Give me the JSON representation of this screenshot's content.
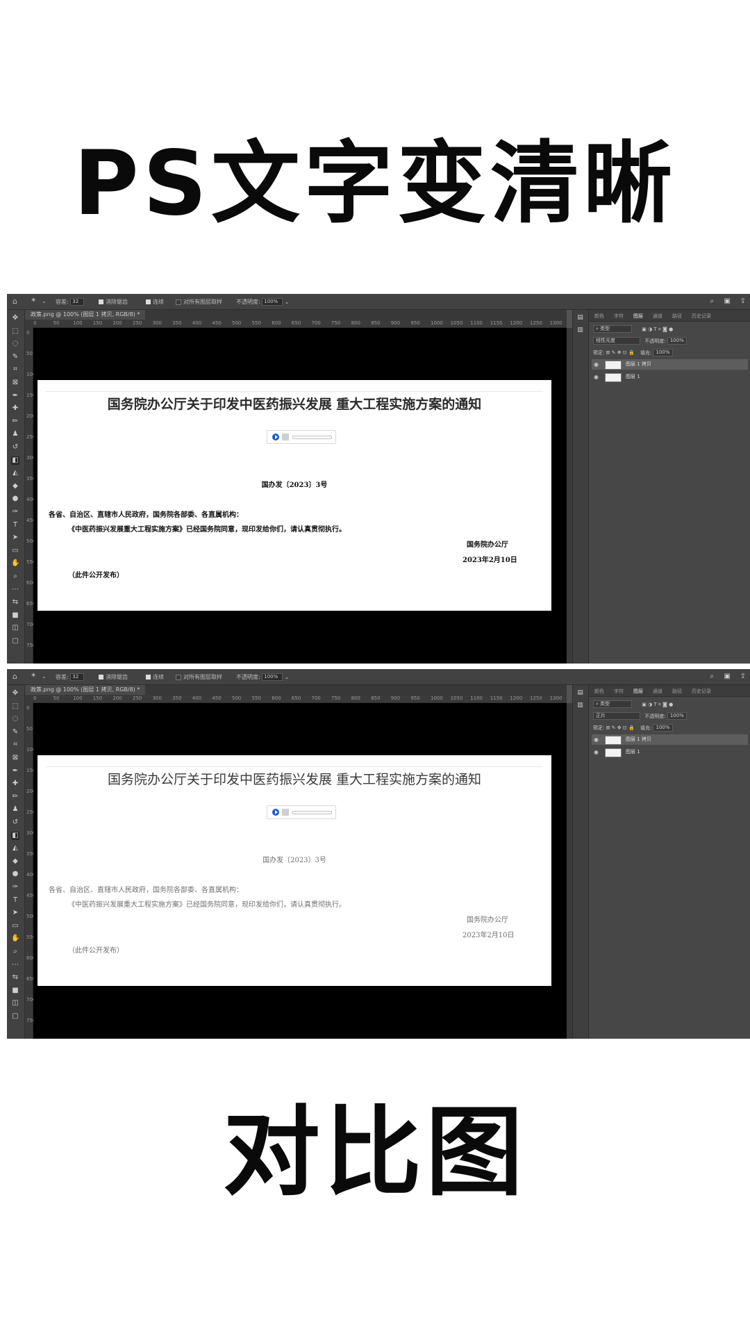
{
  "top_title": "PS文字变清晰",
  "bottom_title": "对比图",
  "screens": [
    {
      "state": "before",
      "options_bar": {
        "size_label": "容差:",
        "size_value": "32",
        "anti_alias": "消除锯齿",
        "contiguous": "连续",
        "sample_all": "对所有图层取样",
        "opacity_label": "不透明度:",
        "opacity_value": "100%"
      },
      "tab_label": "政策.png @ 100% (图层 1 拷贝, RGB/8) *",
      "layers_panel": {
        "tabs": [
          "颜色",
          "字符",
          "图层",
          "通道",
          "路径",
          "历史记录"
        ],
        "active_tab": "图层",
        "filter": "类型",
        "blend_mode": "线性光度",
        "opacity_label": "不透明度:",
        "opacity_value": "100%",
        "lock_label": "锁定:",
        "fill_label": "填充:",
        "fill_value": "100%",
        "layers": [
          {
            "name": "图层 1 拷贝",
            "selected": true
          },
          {
            "name": "图层 1",
            "selected": false
          }
        ]
      }
    },
    {
      "state": "after",
      "options_bar": {
        "size_label": "容差:",
        "size_value": "32",
        "anti_alias": "消除锯齿",
        "contiguous": "连续",
        "sample_all": "对所有图层取样",
        "opacity_label": "不透明度:",
        "opacity_value": "100%"
      },
      "tab_label": "政策.png @ 100% (图层 1 拷贝, RGB/8) *",
      "layers_panel": {
        "tabs": [
          "颜色",
          "字符",
          "图层",
          "通道",
          "路径",
          "历史记录"
        ],
        "active_tab": "图层",
        "filter": "类型",
        "blend_mode": "正片",
        "opacity_label": "不透明度:",
        "opacity_value": "100%",
        "lock_label": "锁定:",
        "fill_label": "填充:",
        "fill_value": "100%",
        "layers": [
          {
            "name": "图层 1 拷贝",
            "selected": true
          },
          {
            "name": "图层 1",
            "selected": false
          }
        ]
      }
    }
  ],
  "document": {
    "title": "国务院办公厅关于印发中医药振兴发展 重大工程实施方案的通知",
    "doc_number": "国办发〔2023〕3号",
    "line1": "各省、自治区、直辖市人民政府，国务院各部委、各直属机构：",
    "line2": "《中医药振兴发展重大工程实施方案》已经国务院同意，现印发给你们，请认真贯彻执行。",
    "issuer": "国务院办公厅",
    "date": "2023年2月10日",
    "note": "（此件公开发布）"
  },
  "ruler_ticks": [
    "0",
    "50",
    "100",
    "150",
    "200",
    "250",
    "300",
    "350",
    "400",
    "450",
    "500",
    "550",
    "600",
    "650",
    "700",
    "750",
    "800",
    "850",
    "900",
    "950",
    "1000",
    "1050",
    "1100",
    "1150",
    "1200",
    "1250",
    "1300"
  ],
  "icons": {
    "home": "home-icon",
    "tool": "magic-wand-icon",
    "search": "search-icon"
  }
}
